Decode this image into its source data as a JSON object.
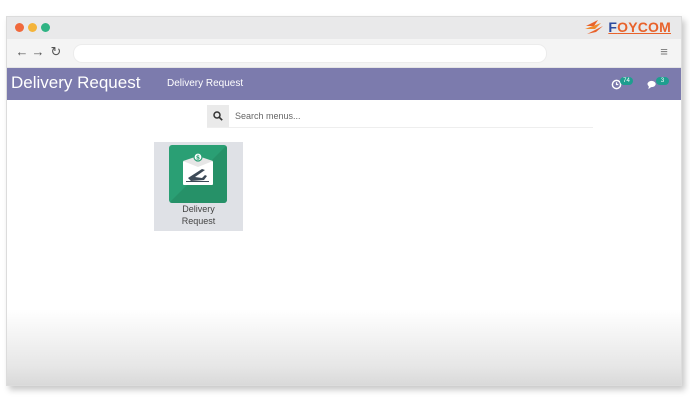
{
  "browser": {
    "window_controls": [
      "close",
      "minimize",
      "maximize"
    ],
    "nav_icons": {
      "back": "arrow-left-icon",
      "forward": "arrow-right-icon",
      "reload": "reload-icon"
    },
    "address_value": "",
    "menu_icon": "hamburger-menu-icon",
    "brand_logo": "FOYCOM"
  },
  "appbar": {
    "title": "Delivery Request",
    "menu_item": "Delivery Request",
    "activity_badge": "74",
    "messages_badge": "3",
    "color": "#7c7bad"
  },
  "search": {
    "placeholder": "Search menus...",
    "value": ""
  },
  "apps": [
    {
      "label_line1": "Delivery",
      "label_line2": "Request",
      "icon": "delivery-plane-box-icon",
      "color": "#2a9f74"
    }
  ],
  "colors": {
    "accent": "#7c7bad",
    "app_icon": "#2a9f74",
    "badge": "#1e9e8f",
    "logo_orange": "#e8622b",
    "logo_blue": "#2c4a9e"
  }
}
